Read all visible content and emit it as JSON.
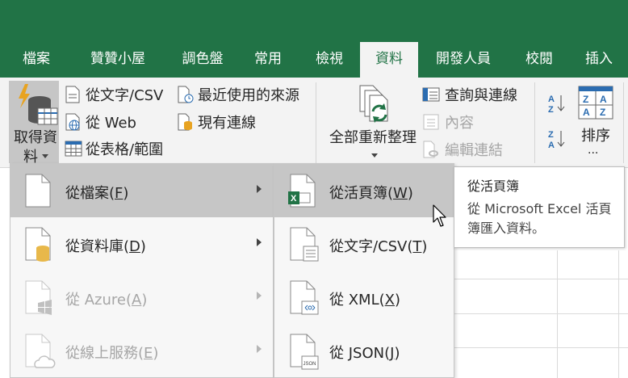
{
  "tabs": [
    {
      "label": "檔案",
      "active": false
    },
    {
      "label": "贊贊小屋",
      "active": false
    },
    {
      "label": "調色盤",
      "active": false
    },
    {
      "label": "常用",
      "active": false
    },
    {
      "label": "檢視",
      "active": false
    },
    {
      "label": "資料",
      "active": true
    },
    {
      "label": "開發人員",
      "active": false
    },
    {
      "label": "校閱",
      "active": false
    },
    {
      "label": "插入",
      "active": false
    }
  ],
  "ribbon": {
    "get_data_line1": "取得資",
    "get_data_line2": "料",
    "from_text_csv": "從文字/CSV",
    "from_web": "從 Web",
    "from_table_range": "從表格/範圍",
    "recent_sources": "最近使用的來源",
    "existing_connections": "現有連線",
    "refresh_all": "全部重新整理",
    "queries_connections": "查詢與連線",
    "properties": "內容",
    "edit_links": "編輯連結",
    "sort": "排序",
    "ellipsis": "..."
  },
  "menu1": {
    "items": [
      {
        "text": "從檔案(",
        "key": "F",
        "end": ")",
        "disabled": false,
        "hover": true
      },
      {
        "text": "從資料庫(",
        "key": "D",
        "end": ")",
        "disabled": false,
        "hover": false
      },
      {
        "text": "從 Azure(",
        "key": "A",
        "end": ")",
        "disabled": true,
        "hover": false
      },
      {
        "text": "從線上服務(",
        "key": "E",
        "end": ")",
        "disabled": true,
        "hover": false
      }
    ]
  },
  "menu2": {
    "items": [
      {
        "text": "從活頁簿(",
        "key": "W",
        "end": ")",
        "hover": true
      },
      {
        "text": "從文字/CSV(",
        "key": "T",
        "end": ")",
        "hover": false
      },
      {
        "text": "從 XML(",
        "key": "X",
        "end": ")",
        "hover": false
      },
      {
        "text": "從 JSON(",
        "key": "J",
        "end": ")",
        "hover": false
      }
    ]
  },
  "icon_labels": {
    "json": "JSON"
  },
  "tooltip": {
    "title": "從活頁簿",
    "body": "從 Microsoft Excel 活頁簿匯入資料。"
  },
  "colors": {
    "excel_green": "#217346",
    "ribbon_bg": "#f3f3f3"
  }
}
